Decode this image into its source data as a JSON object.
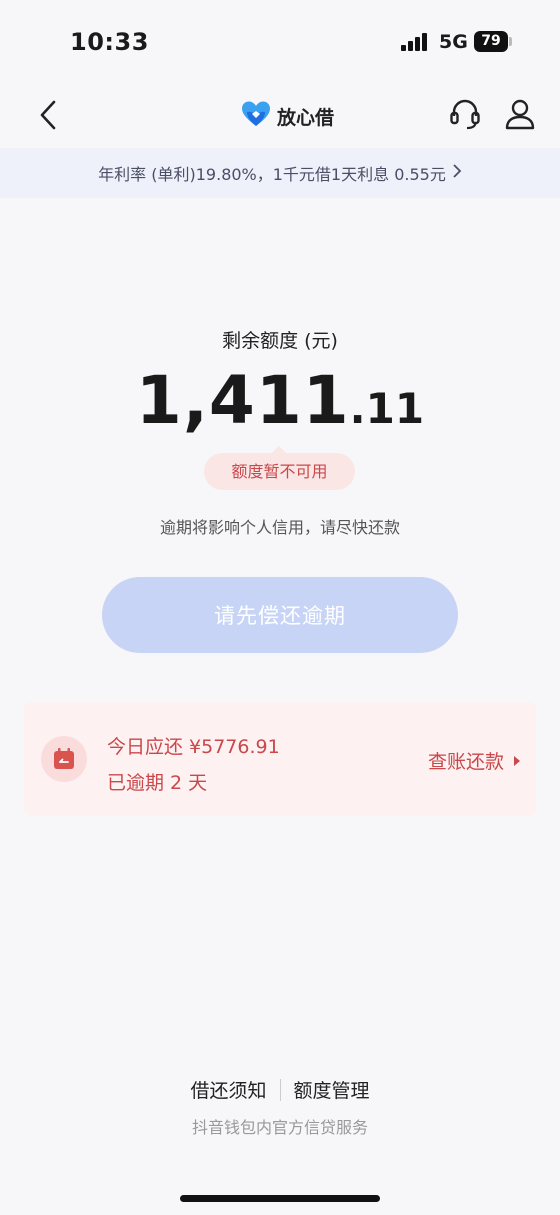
{
  "status_bar": {
    "time": "10:33",
    "network": "5G",
    "battery": "79"
  },
  "nav": {
    "brand_name": "放心借"
  },
  "banner": {
    "text": "年利率 (单利)19.80%，1千元借1天利息 0.55元"
  },
  "credit": {
    "label": "剩余额度 (元)",
    "amount_integer": "1,411",
    "amount_decimal": ".11",
    "status": "额度暂不可用",
    "warning": "逾期将影响个人信用，请尽快还款"
  },
  "repay_button": {
    "label": "请先偿还逾期"
  },
  "due_card": {
    "title": "今日应还 ¥5776.91",
    "overdue": "已逾期 2 天",
    "link": "查账还款"
  },
  "footer": {
    "link_rules": "借还须知",
    "link_limit": "额度管理",
    "subtitle": "抖音钱包内官方信贷服务"
  },
  "colors": {
    "accent_red": "#c9484b",
    "button_disabled": "#c7d4f5",
    "banner_bg": "#eef0fa",
    "card_bg": "#fdf1f1"
  },
  "icons": [
    "signal-icon",
    "battery-icon",
    "back-icon",
    "brand-logo-icon",
    "headset-icon",
    "user-icon",
    "calendar-icon",
    "triangle-right-icon"
  ]
}
